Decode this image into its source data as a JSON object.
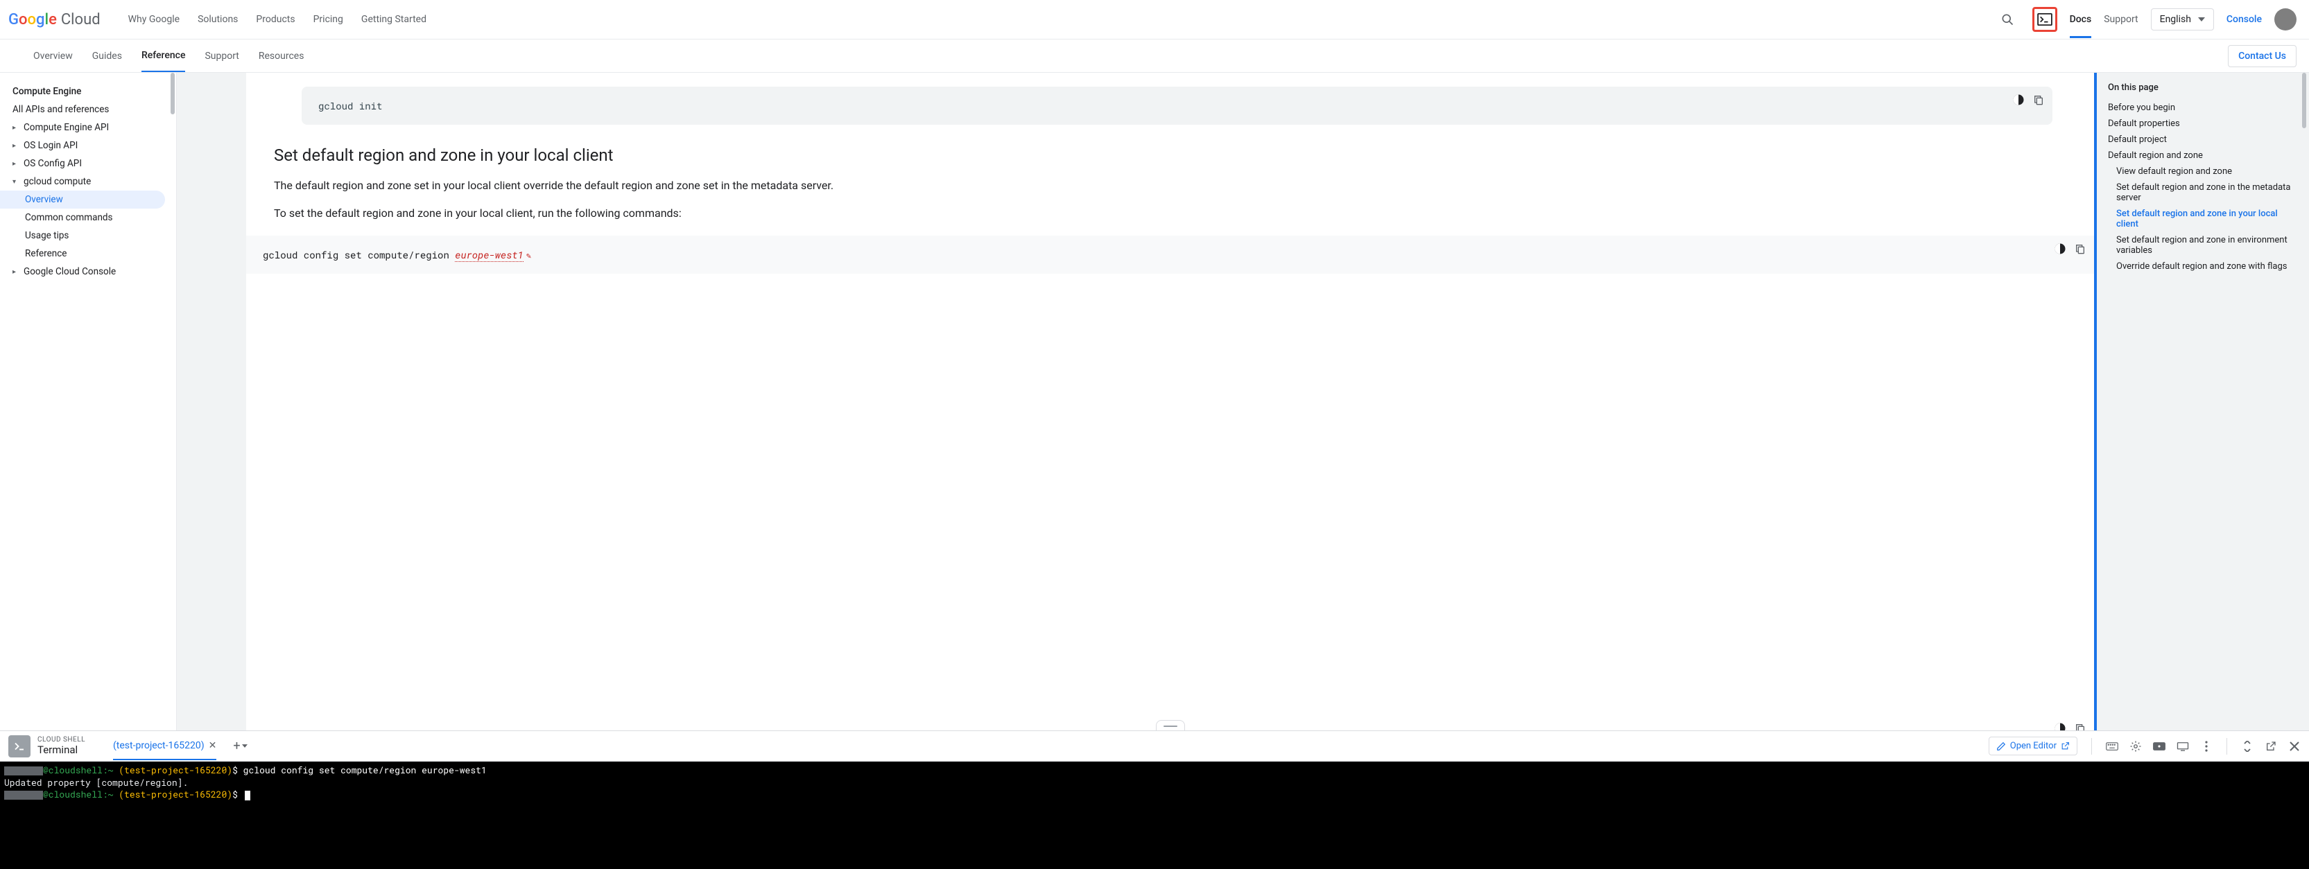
{
  "header": {
    "logo_cloud": "Cloud",
    "nav": [
      "Why Google",
      "Solutions",
      "Products",
      "Pricing",
      "Getting Started"
    ],
    "docs": "Docs",
    "support": "Support",
    "language": "English",
    "console": "Console"
  },
  "subnav": {
    "tabs": [
      "Overview",
      "Guides",
      "Reference",
      "Support",
      "Resources"
    ],
    "active_index": 2,
    "contact": "Contact Us"
  },
  "left_nav": {
    "section_title": "Compute Engine",
    "items": [
      {
        "label": "All APIs and references",
        "arrow": null,
        "indent": 1
      },
      {
        "label": "Compute Engine API",
        "arrow": "right",
        "indent": 0
      },
      {
        "label": "OS Login API",
        "arrow": "right",
        "indent": 0
      },
      {
        "label": "OS Config API",
        "arrow": "right",
        "indent": 0
      },
      {
        "label": "gcloud compute",
        "arrow": "down",
        "indent": 0
      },
      {
        "label": "Overview",
        "arrow": null,
        "indent": 2,
        "active": true
      },
      {
        "label": "Common commands",
        "arrow": null,
        "indent": 2
      },
      {
        "label": "Usage tips",
        "arrow": null,
        "indent": 2
      },
      {
        "label": "Reference",
        "arrow": null,
        "indent": 2
      },
      {
        "label": "Google Cloud Console",
        "arrow": "right",
        "indent": 0
      }
    ]
  },
  "doc": {
    "code1": "gcloud init",
    "h2": "Set default region and zone in your local client",
    "p1": "The default region and zone set in your local client override the default region and zone set in the metadata server.",
    "p2": "To set the default region and zone in your local client, run the following commands:",
    "code2_prefix": "gcloud config set compute/region ",
    "code2_var": "europe-west1"
  },
  "toc": {
    "title": "On this page",
    "items": [
      {
        "label": "Before you begin",
        "sub": false
      },
      {
        "label": "Default properties",
        "sub": false
      },
      {
        "label": "Default project",
        "sub": false
      },
      {
        "label": "Default region and zone",
        "sub": false
      },
      {
        "label": "View default region and zone",
        "sub": true
      },
      {
        "label": "Set default region and zone in the metadata server",
        "sub": true
      },
      {
        "label": "Set default region and zone in your local client",
        "sub": true,
        "active": true
      },
      {
        "label": "Set default region and zone in environment variables",
        "sub": true
      },
      {
        "label": "Override default region and zone with flags",
        "sub": true
      }
    ]
  },
  "shell": {
    "label": "CLOUD SHELL",
    "terminal_label": "Terminal",
    "tab_name": "(test-project-165220)",
    "open_editor": "Open Editor",
    "line1_host": "@cloudshell:",
    "line1_tilde": "~ ",
    "line1_project": "(test-project-165220)",
    "line1_dollar": "$ ",
    "line1_cmd": "gcloud config set compute/region europe-west1",
    "line2": "Updated property [compute/region].",
    "line3_host": "@cloudshell:",
    "line3_tilde": "~ ",
    "line3_project": "(test-project-165220)",
    "line3_dollar": "$ "
  }
}
